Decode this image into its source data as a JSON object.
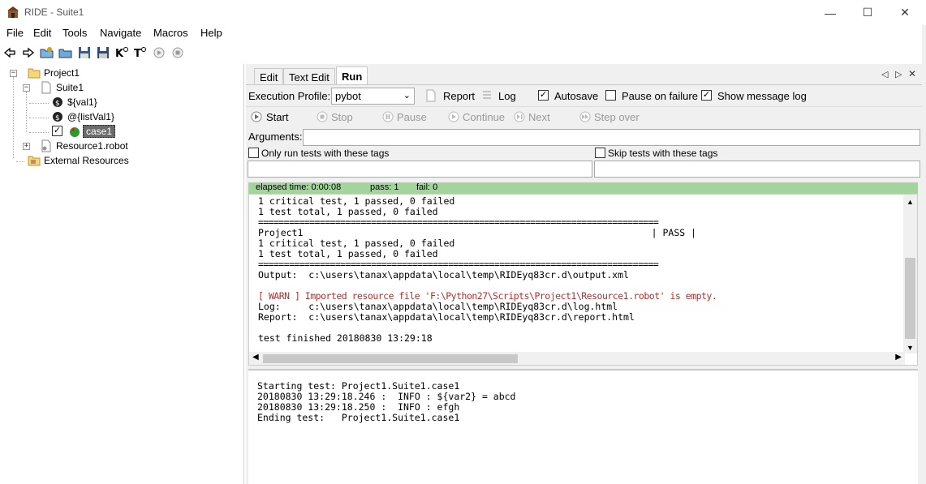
{
  "window": {
    "title": "RIDE - Suite1",
    "minimize": "—",
    "maximize": "☐",
    "close": "✕"
  },
  "menu": {
    "items": [
      "File",
      "Edit",
      "Tools",
      "Navigate",
      "Macros",
      "Help"
    ]
  },
  "tree": {
    "project": "Project1",
    "suite": "Suite1",
    "var1": "${val1}",
    "var2": "@{listVal1}",
    "testcase": "case1",
    "resource": "Resource1.robot",
    "external": "External Resources"
  },
  "tabs": {
    "edit": "Edit",
    "text_edit": "Text Edit",
    "run": "Run"
  },
  "run": {
    "execution_profile_label": "Execution Profile:",
    "profile_value": "pybot",
    "report": "Report",
    "log": "Log",
    "autosave": "Autosave",
    "pause_on_failure": "Pause on failure",
    "show_message_log": "Show message log",
    "start": "Start",
    "stop": "Stop",
    "pause": "Pause",
    "continue": "Continue",
    "next": "Next",
    "step_over": "Step over",
    "arguments_label": "Arguments:",
    "only_run_tags": "Only run tests with these tags",
    "skip_tags": "Skip tests with these tags"
  },
  "status": {
    "elapsed": "elapsed time: 0:00:08",
    "pass": "pass: 1",
    "fail": "fail: 0"
  },
  "console": {
    "lines": [
      "1 critical test, 1 passed, 0 failed",
      "1 test total, 1 passed, 0 failed",
      "==============================================================================",
      "Project1                                                              | PASS |",
      "1 critical test, 1 passed, 0 failed",
      "1 test total, 1 passed, 0 failed",
      "==============================================================================",
      "Output:  c:\\users\\tanax\\appdata\\local\\temp\\RIDEyq83cr.d\\output.xml",
      "",
      "[ WARN ] Imported resource file 'F:\\Python27\\Scripts\\Project1\\Resource1.robot' is empty.",
      "Log:     c:\\users\\tanax\\appdata\\local\\temp\\RIDEyq83cr.d\\log.html",
      "Report:  c:\\users\\tanax\\appdata\\local\\temp\\RIDEyq83cr.d\\report.html",
      "",
      "test finished 20180830 13:29:18"
    ]
  },
  "message_log": {
    "lines": [
      "Starting test: Project1.Suite1.case1",
      "20180830 13:29:18.246 :  INFO : ${var2} = abcd",
      "20180830 13:29:18.250 :  INFO : efgh",
      "Ending test:   Project1.Suite1.case1"
    ]
  },
  "colors": {
    "status_green": "#a4d49e",
    "warn_red": "#b03030"
  }
}
